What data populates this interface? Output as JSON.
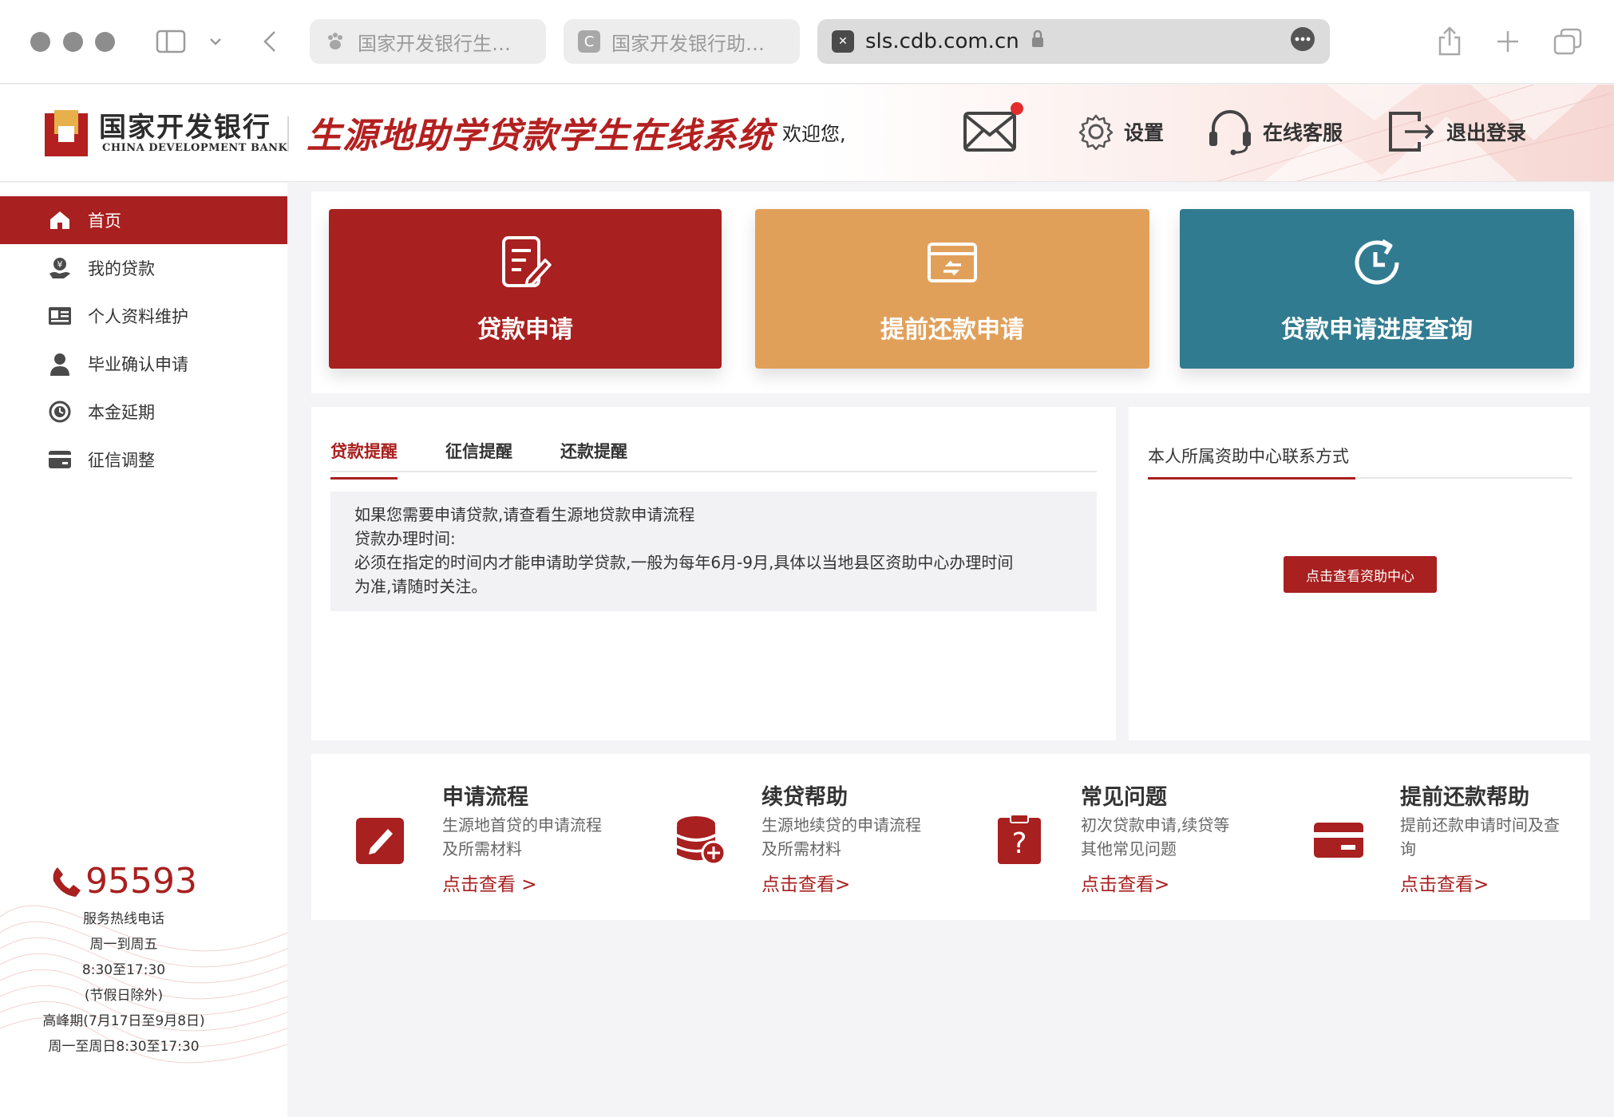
{
  "browser": {
    "tabs": [
      {
        "label": "国家开发银行生…"
      },
      {
        "label": "国家开发银行助…",
        "favicon_letter": "C"
      },
      {
        "label": "sls.cdb.com.cn"
      }
    ]
  },
  "header": {
    "bank_name_cn": "国家开发银行",
    "bank_name_en": "CHINA DEVELOPMENT BANK",
    "system_title": "生源地助学贷款学生在线系统",
    "welcome": "欢迎您,",
    "settings": "设置",
    "support": "在线客服",
    "logout": "退出登录"
  },
  "sidebar": {
    "items": [
      {
        "label": "首页",
        "icon": "home-icon"
      },
      {
        "label": "我的贷款",
        "icon": "loan-icon"
      },
      {
        "label": "个人资料维护",
        "icon": "id-card-icon"
      },
      {
        "label": "毕业确认申请",
        "icon": "graduate-icon"
      },
      {
        "label": "本金延期",
        "icon": "clock-icon"
      },
      {
        "label": "征信调整",
        "icon": "card-icon"
      }
    ],
    "hotline": {
      "number": "95593",
      "lines": [
        "服务热线电话",
        "周一到周五",
        "8:30至17:30",
        "(节假日除外)",
        "高峰期(7月17日至9月8日)",
        "周一至周日8:30至17:30"
      ]
    }
  },
  "cards": [
    {
      "label": "贷款申请",
      "color": "#a8201f"
    },
    {
      "label": "提前还款申请",
      "color": "#e1a05a"
    },
    {
      "label": "贷款申请进度查询",
      "color": "#317b90"
    }
  ],
  "notice": {
    "tabs": [
      "贷款提醒",
      "征信提醒",
      "还款提醒"
    ],
    "lines": [
      "如果您需要申请贷款,请查看生源地贷款申请流程",
      "贷款办理时间:",
      "必须在指定的时间内才能申请助学贷款,一般为每年6月-9月,具体以当地县区资助中心办理时间",
      "为准,请随时关注。"
    ]
  },
  "contact": {
    "title": "本人所属资助中心联系方式",
    "button": "点击查看资助中心"
  },
  "help": [
    {
      "title": "申请流程",
      "desc": "生源地首贷的申请流程及所需材料",
      "link": "点击查看 >"
    },
    {
      "title": "续贷帮助",
      "desc": "生源地续贷的申请流程及所需材料",
      "link": "点击查看>"
    },
    {
      "title": "常见问题",
      "desc": "初次贷款申请,续贷等其他常见问题",
      "link": "点击查看>"
    },
    {
      "title": "提前还款帮助",
      "desc": "提前还款申请时间及查询",
      "link": "点击查看>"
    }
  ],
  "colors": {
    "brand_red": "#a8201f",
    "orange": "#e1a05a",
    "teal": "#317b90"
  }
}
